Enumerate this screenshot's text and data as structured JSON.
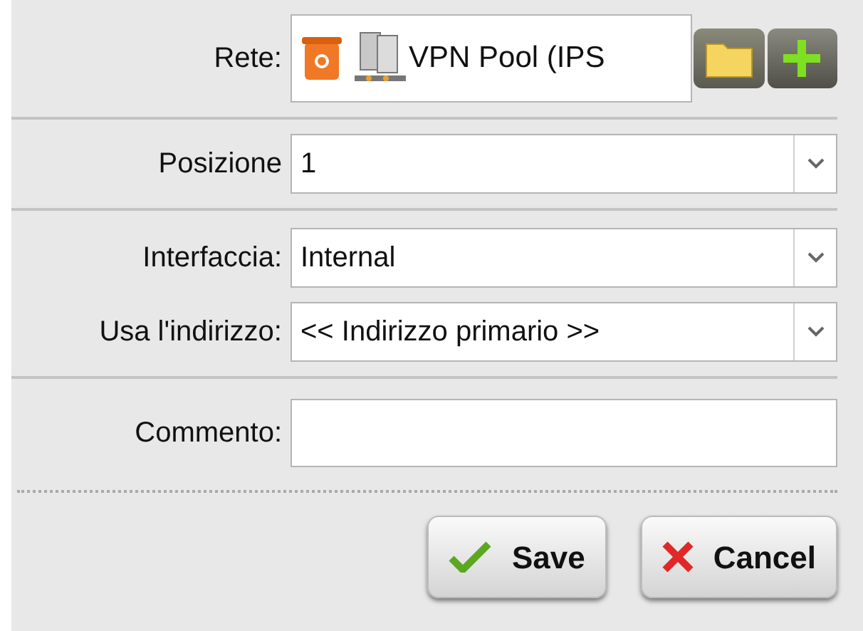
{
  "network": {
    "label": "Rete:",
    "value": "VPN Pool (IPS"
  },
  "position": {
    "label": "Posizione",
    "value": "1"
  },
  "interface": {
    "label": "Interfaccia:",
    "value": "Internal"
  },
  "address": {
    "label": "Usa l'indirizzo:",
    "value": "<< Indirizzo primario >>"
  },
  "comment": {
    "label": "Commento:"
  },
  "buttons": [
    {
      "kind": "save",
      "label": "Save"
    },
    {
      "kind": "cancel",
      "label": "Cancel"
    }
  ]
}
